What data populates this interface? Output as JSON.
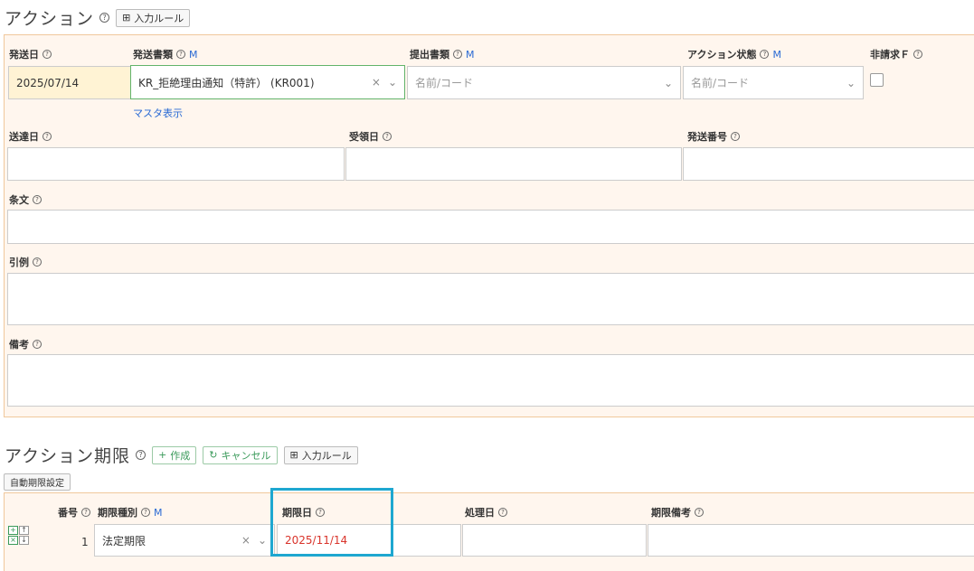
{
  "action_section": {
    "title": "アクション",
    "input_rule_button": "入力ルール",
    "fields": {
      "send_date": {
        "label": "発送日",
        "value": "2025/07/14"
      },
      "send_doc": {
        "label": "発送書類",
        "m": "M",
        "value": "KR_拒絶理由通知（特許） (KR001)",
        "master_link": "マスタ表示"
      },
      "submit_doc": {
        "label": "提出書類",
        "m": "M",
        "placeholder": "名前/コード"
      },
      "action_status": {
        "label": "アクション状態",
        "m": "M",
        "placeholder": "名前/コード"
      },
      "non_claim": {
        "label": "非請求Ｆ"
      },
      "delivery_date": {
        "label": "送達日"
      },
      "receipt_date": {
        "label": "受領日"
      },
      "send_number": {
        "label": "発送番号"
      },
      "article": {
        "label": "条文"
      },
      "citation": {
        "label": "引例"
      },
      "remarks": {
        "label": "備考"
      }
    }
  },
  "deadline_section": {
    "title": "アクション期限",
    "create_button": "作成",
    "cancel_button": "キャンセル",
    "input_rule_button": "入力ルール",
    "auto_button": "自動期限設定",
    "columns": {
      "number": "番号",
      "type": "期限種別",
      "type_m": "M",
      "due_date": "期限日",
      "process_date": "処理日",
      "note": "期限備考"
    },
    "rows": [
      {
        "number": "1",
        "type": "法定期限",
        "due_date": "2025/11/14"
      }
    ]
  },
  "icons": {
    "help": "?",
    "table": "⊞",
    "plus": "+",
    "refresh": "↻",
    "clear": "×",
    "chevron": "⌄"
  }
}
